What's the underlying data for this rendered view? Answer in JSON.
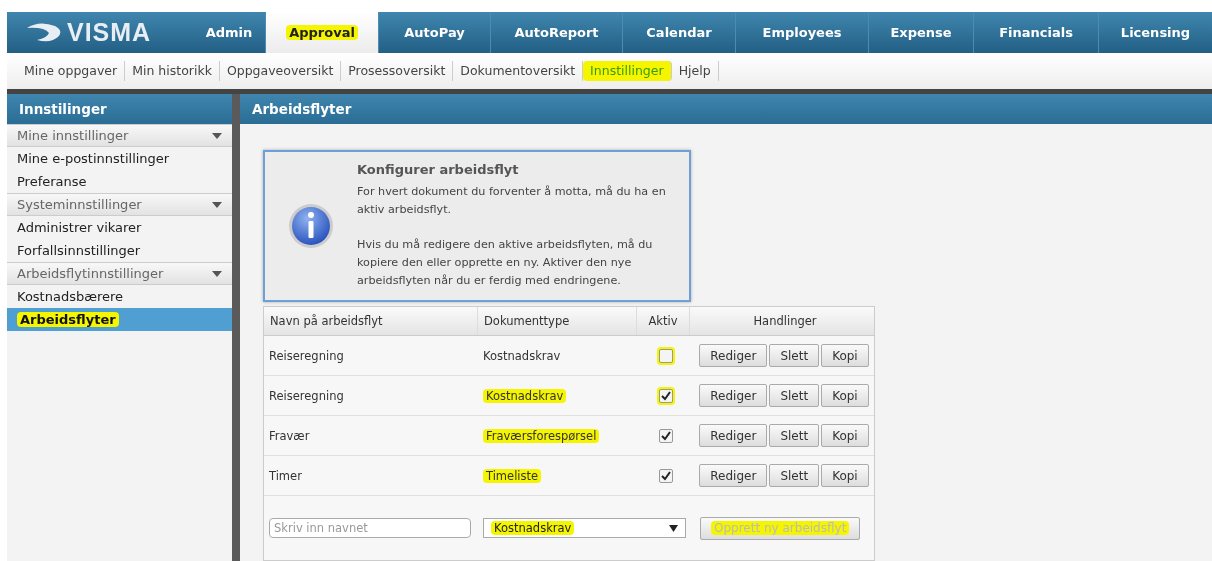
{
  "logo": {
    "text": "VISMA"
  },
  "tabs": [
    {
      "label": "Admin",
      "selected": false,
      "highlighted": false
    },
    {
      "label": "Approval",
      "selected": true,
      "highlighted": true
    },
    {
      "label": "AutoPay",
      "selected": false,
      "highlighted": false
    },
    {
      "label": "AutoReport",
      "selected": false,
      "highlighted": false
    },
    {
      "label": "Calendar",
      "selected": false,
      "highlighted": false
    },
    {
      "label": "Employees",
      "selected": false,
      "highlighted": false
    },
    {
      "label": "Expense",
      "selected": false,
      "highlighted": false
    },
    {
      "label": "Financials",
      "selected": false,
      "highlighted": false
    },
    {
      "label": "Licensing",
      "selected": false,
      "highlighted": false
    }
  ],
  "subnav": [
    {
      "label": "Mine oppgaver",
      "selected": false,
      "highlighted": false
    },
    {
      "label": "Min historikk",
      "selected": false,
      "highlighted": false
    },
    {
      "label": "Oppgaveoversikt",
      "selected": false,
      "highlighted": false
    },
    {
      "label": "Prosessoversikt",
      "selected": false,
      "highlighted": false
    },
    {
      "label": "Dokumentoversikt",
      "selected": false,
      "highlighted": false
    },
    {
      "label": "Innstillinger",
      "selected": true,
      "highlighted": true
    },
    {
      "label": "Hjelp",
      "selected": false,
      "highlighted": false
    }
  ],
  "sidebar": {
    "title": "Innstilinger",
    "groups": [
      {
        "label": "Mine innstillinger",
        "expanded": true,
        "items": [
          {
            "label": "Mine e-postinnstillinger",
            "selected": false,
            "highlighted": false
          },
          {
            "label": "Preferanse",
            "selected": false,
            "highlighted": false
          }
        ]
      },
      {
        "label": "Systeminnstillinger",
        "expanded": true,
        "items": [
          {
            "label": "Administrer vikarer",
            "selected": false,
            "highlighted": false
          },
          {
            "label": "Forfallsinnstillinger",
            "selected": false,
            "highlighted": false
          }
        ]
      },
      {
        "label": "Arbeidsflytinnstillinger",
        "expanded": true,
        "items": [
          {
            "label": "Kostnadsbærere",
            "selected": false,
            "highlighted": false
          },
          {
            "label": "Arbeidsflyter",
            "selected": true,
            "highlighted": true
          }
        ]
      }
    ]
  },
  "main": {
    "title": "Arbeidsflyter",
    "info": {
      "title": "Konfigurer arbeidsflyt",
      "paragraphs": [
        "For hvert dokument du forventer å motta, må du ha en aktiv arbeidsflyt.",
        "Hvis du må redigere den aktive arbeidsflyten, må du kopiere den eller opprette en ny. Aktiver den nye arbeidsflyten når du er ferdig med endringene."
      ]
    },
    "table": {
      "columns": [
        "Navn på arbeidsflyt",
        "Dokumenttype",
        "Aktiv",
        "Handlinger"
      ],
      "rows": [
        {
          "name": "Reiseregning",
          "type": "Kostnadskrav",
          "type_highlighted": false,
          "active": false,
          "active_highlighted": true,
          "actions": [
            "Rediger",
            "Slett",
            "Kopi"
          ]
        },
        {
          "name": "Reiseregning",
          "type": "Kostnadskrav",
          "type_highlighted": true,
          "active": true,
          "active_highlighted": true,
          "actions": [
            "Rediger",
            "Slett",
            "Kopi"
          ]
        },
        {
          "name": "Fravær",
          "type": "Fraværsforespørsel",
          "type_highlighted": true,
          "active": true,
          "active_highlighted": false,
          "actions": [
            "Rediger",
            "Slett",
            "Kopi"
          ]
        },
        {
          "name": "Timer",
          "type": "Timeliste",
          "type_highlighted": true,
          "active": true,
          "active_highlighted": false,
          "actions": [
            "Rediger",
            "Slett",
            "Kopi"
          ]
        }
      ],
      "new_row": {
        "name_placeholder": "Skriv inn navnet",
        "type_value": "Kostnadskrav",
        "create_button": "Opprett ny arbeidsflyt",
        "create_disabled": true,
        "highlighted": true
      }
    }
  }
}
